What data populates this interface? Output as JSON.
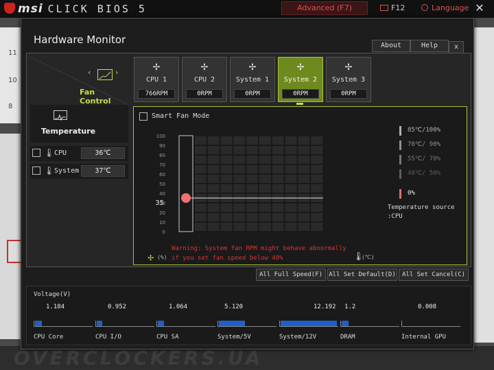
{
  "topbar": {
    "brand": "msi",
    "product": "CLICK BIOS 5",
    "advanced_tab": "Advanced (F7)",
    "f12_label": "F12",
    "language_label": "Language",
    "close_glyph": "✕"
  },
  "background": {
    "left_numbers": [
      "11",
      "10",
      "8"
    ]
  },
  "dialog": {
    "title": "Hardware Monitor",
    "about": "About",
    "help": "Help",
    "close": "x"
  },
  "left_panel": {
    "fan_control_label": "Fan Control",
    "temperature_label": "Temperature",
    "sensors": [
      {
        "name": "CPU",
        "value": "36℃"
      },
      {
        "name": "System",
        "value": "37℃"
      }
    ]
  },
  "fans": [
    {
      "name": "CPU 1",
      "rpm": "766RPM",
      "active": false
    },
    {
      "name": "CPU 2",
      "rpm": "0RPM",
      "active": false
    },
    {
      "name": "System 1",
      "rpm": "0RPM",
      "active": false
    },
    {
      "name": "System 2",
      "rpm": "0RPM",
      "active": true
    },
    {
      "name": "System 3",
      "rpm": "0RPM",
      "active": false
    }
  ],
  "chart_panel": {
    "smart_fan_mode": "Smart Fan Mode",
    "legend": [
      {
        "text": "85℃/100%",
        "color": "#b0b0b0"
      },
      {
        "text": "70℃/ 90%",
        "color": "#909090"
      },
      {
        "text": "55℃/ 70%",
        "color": "#777777"
      },
      {
        "text": "40℃/ 50%",
        "color": "#5e5e5e"
      },
      {
        "text": "0%",
        "color": "#e07070"
      }
    ],
    "temperature_source": "Temperature source",
    "temperature_source_value": ":CPU",
    "warning_line1": "Warning: System fan RPM might behave abnormally",
    "warning_line2": "if you set fan speed below 40%",
    "pct_axis": "(%)",
    "degc_axis": "(℃)",
    "current_value_label": "35"
  },
  "chart_data": {
    "type": "line",
    "y_ticks": [
      "100",
      "90",
      "80",
      "70",
      "60",
      "50",
      "40",
      "30",
      "20",
      "10",
      "0"
    ],
    "ylim": [
      0,
      100
    ],
    "x_grid_columns": 10,
    "set_point": 35,
    "fan_speed_line": 35
  },
  "actions": {
    "full_speed": "All Full Speed(F)",
    "set_default": "All Set Default(D)",
    "set_cancel": "All Set Cancel(C)"
  },
  "voltage": {
    "title": "Voltage(V)",
    "items": [
      {
        "name": "CPU Core",
        "value": "1.184",
        "fill": 0.12
      },
      {
        "name": "CPU I/O",
        "value": "0.952",
        "fill": 0.1
      },
      {
        "name": "CPU SA",
        "value": "1.064",
        "fill": 0.11
      },
      {
        "name": "System/5V",
        "value": "5.120",
        "fill": 0.45
      },
      {
        "name": "System/12V",
        "value": "12.192",
        "fill": 0.98
      },
      {
        "name": "DRAM",
        "value": "1.2",
        "fill": 0.12
      },
      {
        "name": "Internal GPU",
        "value": "0.008",
        "fill": 0.0
      }
    ]
  },
  "watermark": "OVERCLOCKERS.UA",
  "colors": {
    "accent": "#a9c23a",
    "accent_text": "#c8dc4a",
    "warning": "#dd3333",
    "volt_bar": "#1f5fc8",
    "marker": "#f07070"
  }
}
